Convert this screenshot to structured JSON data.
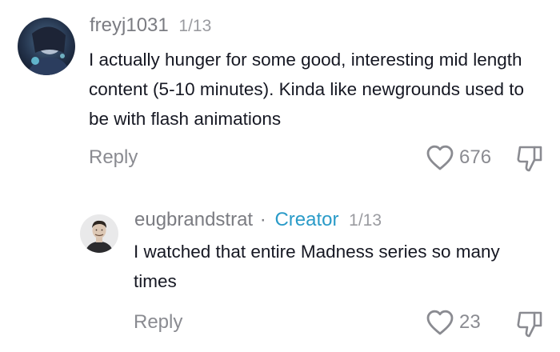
{
  "comments": [
    {
      "username": "freyj1031",
      "date": "1/13",
      "text": "I actually hunger for some good, interesting mid length content (5-10 minutes). Kinda like newgrounds used to be with flash animations",
      "reply_label": "Reply",
      "like_count": "676",
      "icons": {
        "like": "heart-outline-icon",
        "dislike": "thumbs-down-icon"
      }
    },
    {
      "username": "eugbrandstrat",
      "separator": "·",
      "badge": "Creator",
      "date": "1/13",
      "text": "I watched that entire Madness series so many times",
      "reply_label": "Reply",
      "like_count": "23",
      "icons": {
        "like": "heart-outline-icon",
        "dislike": "thumbs-down-icon"
      }
    }
  ],
  "colors": {
    "username": "#7b7c82",
    "creator_badge": "#2a9bc8",
    "text": "#161823",
    "muted": "#8a8b91"
  }
}
